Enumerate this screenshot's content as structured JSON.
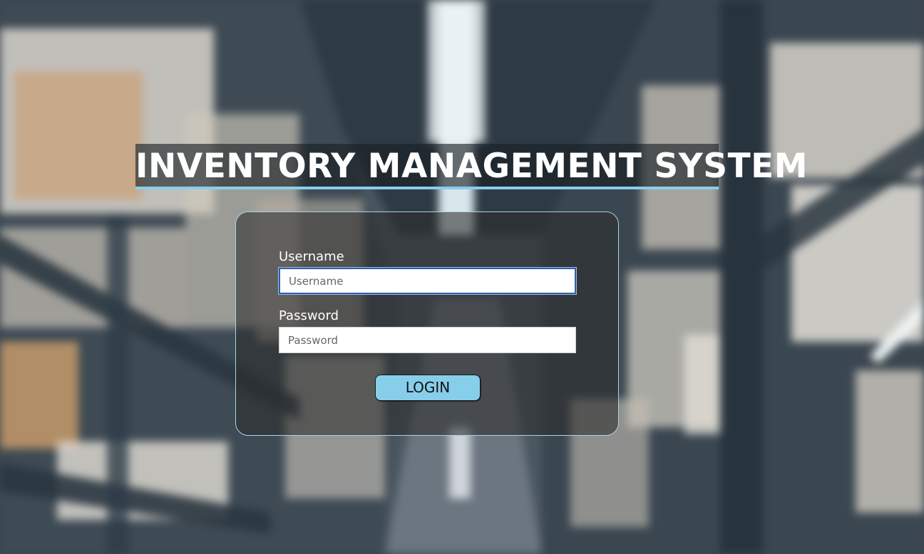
{
  "header": {
    "title": "INVENTORY MANAGEMENT SYSTEM"
  },
  "login_form": {
    "username_label": "Username",
    "username_placeholder": "Username",
    "username_value": "",
    "password_label": "Password",
    "password_placeholder": "Password",
    "password_value": "",
    "login_button": "LOGIN"
  },
  "colors": {
    "accent": "#87ceeb",
    "focus_border": "#2e5fa8",
    "card_border": "#a6d4e6"
  },
  "background": {
    "description_icon": "warehouse-shelves-image"
  }
}
